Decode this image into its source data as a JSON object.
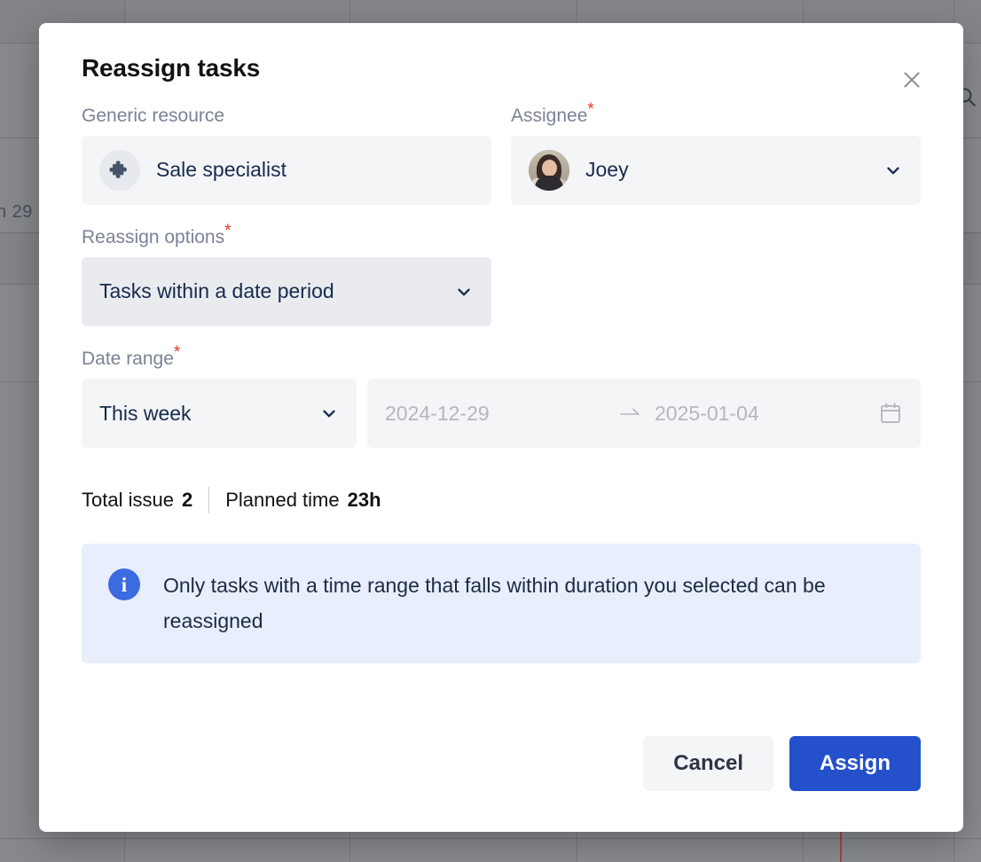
{
  "background": {
    "date_label": "n 29",
    "search_icon": "search-icon"
  },
  "modal": {
    "title": "Reassign tasks",
    "close_icon": "close-icon",
    "fields": {
      "generic_resource": {
        "label": "Generic resource",
        "required": false,
        "icon": "puzzle-piece-icon",
        "value": "Sale specialist"
      },
      "assignee": {
        "label": "Assignee",
        "required": true,
        "required_marker": "*",
        "avatar": "user-avatar",
        "value": "Joey",
        "chevron_icon": "chevron-down-icon"
      },
      "reassign_options": {
        "label": "Reassign options",
        "required": true,
        "required_marker": "*",
        "value": "Tasks within a date period",
        "chevron_icon": "chevron-down-icon"
      },
      "date_range": {
        "label": "Date range",
        "required": true,
        "required_marker": "*",
        "period": "This week",
        "period_chevron_icon": "chevron-down-icon",
        "start_date": "2024-12-29",
        "end_date": "2025-01-04",
        "separator_icon": "arrow-right-icon",
        "calendar_icon": "calendar-icon"
      }
    },
    "summary": {
      "total_issue_label": "Total issue",
      "total_issue_value": "2",
      "planned_time_label": "Planned time",
      "planned_time_value": "23h"
    },
    "banner": {
      "icon": "info-icon",
      "text": "Only tasks with a time range that falls within duration you selected can be reassigned"
    },
    "footer": {
      "cancel_label": "Cancel",
      "assign_label": "Assign"
    }
  },
  "colors": {
    "primary": "#2550cc",
    "required": "#e5342b",
    "banner_bg": "#e8eefc",
    "field_bg": "#f4f5f7",
    "select_bg": "#e9ebef",
    "label": "#7a8294",
    "text": "#172b4d"
  }
}
